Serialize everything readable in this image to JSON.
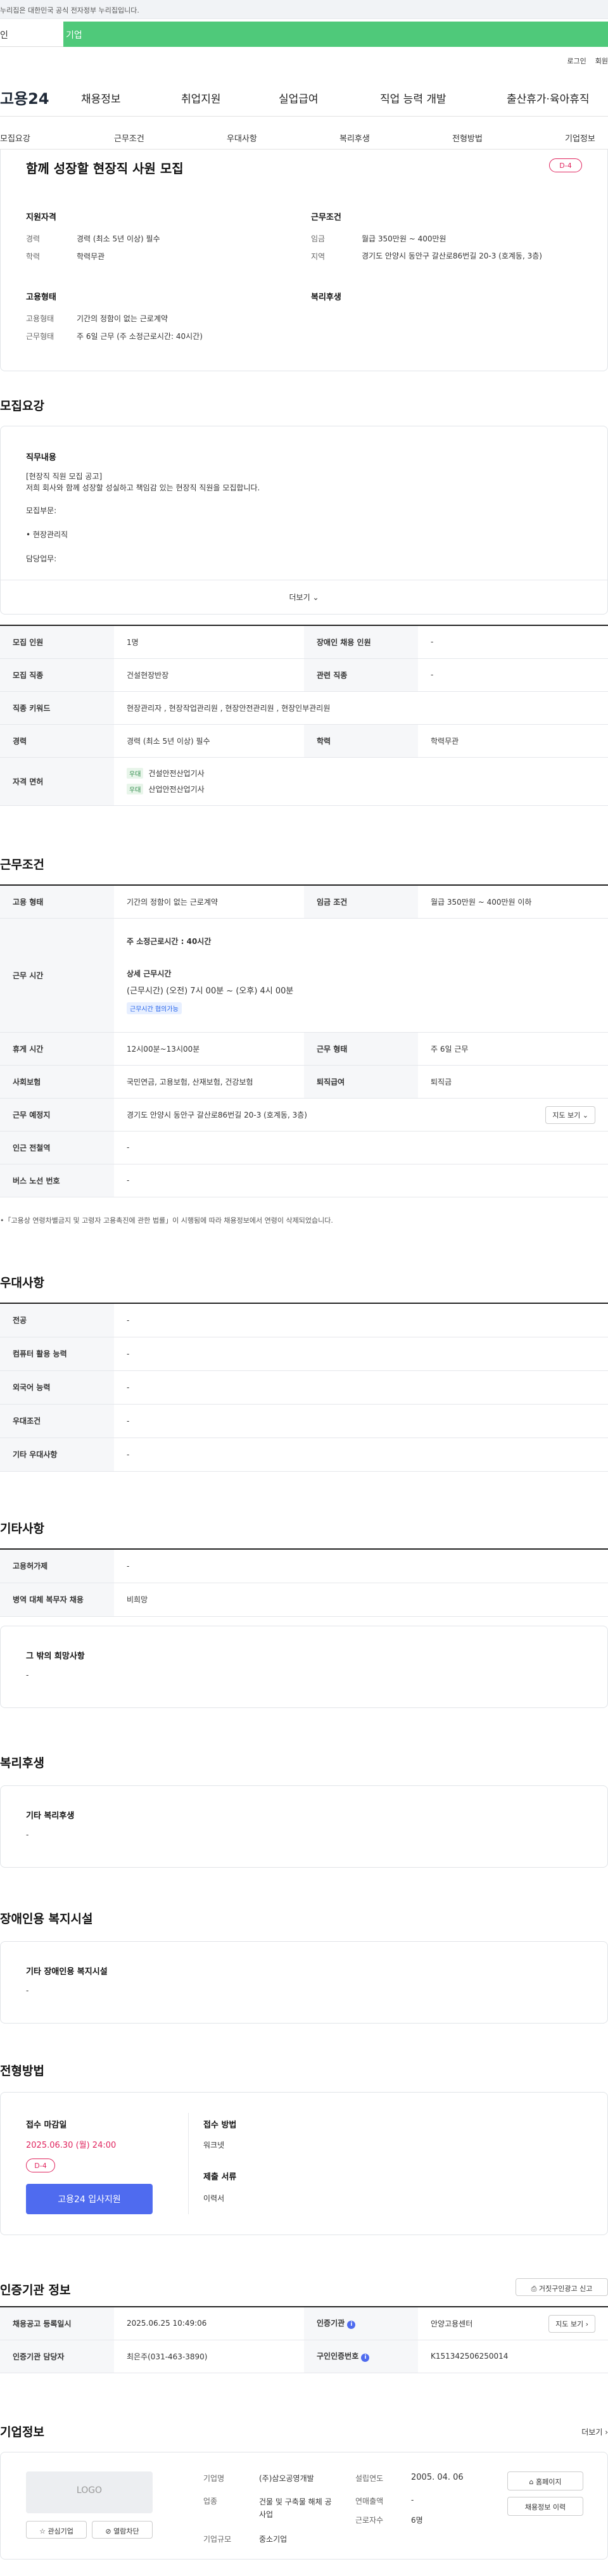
{
  "gov_banner": "누리집은 대한민국 공식 전자정부 누리집입니다.",
  "user_tabs": {
    "person": "인",
    "company": "기업"
  },
  "top_links": {
    "login": "로그인",
    "join": "회원"
  },
  "gnb": {
    "logo": "고용24",
    "menu": [
      "채용정보",
      "취업지원",
      "실업급여",
      "직업 능력 개발",
      "출산휴가·육아휴직"
    ]
  },
  "subnav": [
    "모집요강",
    "근무조건",
    "우대사항",
    "복리후생",
    "전형방법",
    "기업정보"
  ],
  "summary": {
    "title": "함께 성장할 현장직 사원 모집",
    "dday": "D-4",
    "qual_h": "지원자격",
    "exp_l": "경력",
    "exp_v": "경력 (최소 5년 이상) 필수",
    "edu_l": "학력",
    "edu_v": "학력무관",
    "cond_h": "근무조건",
    "wage_l": "임금",
    "wage_v": "월급 350만원 ~ 400만원",
    "loc_l": "지역",
    "loc_v": "경기도 안양시 동안구 갈산로86번길 20-3 (호계동, 3층)",
    "emp_h": "고용형태",
    "type_l": "고용형태",
    "type_v": "기간의 정함이 없는 근로계약",
    "work_l": "근무형태",
    "work_v": "주 6일 근무 (주 소정근로시간: 40시간)",
    "welfare_h": "복리후생"
  },
  "recruit": {
    "title": "모집요강",
    "duty_h": "직무내용",
    "duty_lines": [
      "[현장직 직원 모집 공고]",
      "저희 회사와 함께 성장할 성실하고 책임감 있는 현장직 직원을 모집합니다.",
      "모집부문:",
      "• 현장관리직",
      "담당업무:"
    ],
    "more": "더보기",
    "rows": {
      "r1": {
        "k1": "모집 인원",
        "v1": "1명",
        "k2": "장애인 채용 인원",
        "v2": "-"
      },
      "r2": {
        "k1": "모집 직종",
        "v1": "건설현장반장",
        "k2": "관련 직종",
        "v2": "-"
      },
      "r3": {
        "k1": "직종 키워드",
        "v1": "현장관리자 , 현장작업관리원 , 현장안전관리원 , 현장인부관리원"
      },
      "r4": {
        "k1": "경력",
        "v1": "경력 (최소 5년 이상) 필수",
        "k2": "학력",
        "v2": "학력무관"
      },
      "r5": {
        "k1": "자격 면허",
        "tag": "우대",
        "lic1": "건설안전산업기사",
        "lic2": "산업안전산업기사"
      }
    }
  },
  "conditions": {
    "title": "근무조건",
    "emp_k": "고용 형태",
    "emp_v": "기간의 정함이 없는 근로계약",
    "wage_k": "임금 조건",
    "wage_v": "월급 350만원 ~ 400만원 이하",
    "hours_k": "근무 시간",
    "hours_main": "주 소정근로시간 : 40시간",
    "hours_detail_h": "상세 근무시간",
    "hours_detail": "(근무시간) (오전) 7시 00분 ~ (오후) 4시 00분",
    "hours_tag": "근무시간 협의가능",
    "rest_k": "휴게 시간",
    "rest_v": "12시00분~13시00분",
    "form_k": "근무 형태",
    "form_v": "주 6일 근무",
    "ins_k": "사회보험",
    "ins_v": "국민연금, 고용보험, 산재보험, 건강보험",
    "sev_k": "퇴직급여",
    "sev_v": "퇴직금",
    "place_k": "근무 예정지",
    "place_v": "경기도 안양시 동안구 갈산로86번길 20-3 (호계동, 3층)",
    "map_btn": "지도 보기",
    "subway_k": "인근 전철역",
    "subway_v": "-",
    "bus_k": "버스 노선 번호",
    "bus_v": "-",
    "note": "•「고용상 연령차별금지 및 고령자 고용촉진에 관한 법률」이 시행됨에 따라 채용정보에서 연령이 삭제되었습니다."
  },
  "pref": {
    "title": "우대사항",
    "rows": [
      [
        "전공",
        "-"
      ],
      [
        "컴퓨터 활용 능력",
        "-"
      ],
      [
        "외국어 능력",
        "-"
      ],
      [
        "우대조건",
        "-"
      ],
      [
        "기타 우대사항",
        "-"
      ]
    ]
  },
  "etc": {
    "title": "기타사항",
    "rows": [
      [
        "고용허가제",
        "-"
      ],
      [
        "병역 대체 복무자 채용",
        "비희망"
      ]
    ],
    "wish_h": "그 밖의 희망사항",
    "wish_v": "-"
  },
  "welfare": {
    "title": "복리후생",
    "h": "기타 복리후생",
    "v": "-"
  },
  "disabled": {
    "title": "장애인용 복지시설",
    "h": "기타 장애인용 복지시설",
    "v": "-"
  },
  "process": {
    "title": "전형방법",
    "deadline_h": "접수 마감일",
    "deadline": "2025.06.30 (월) 24:00",
    "dday": "D-4",
    "apply": "고용24 입사지원",
    "method_h": "접수 방법",
    "method_v": "워크넷",
    "docs_h": "제출 서류",
    "docs_v": "이력서"
  },
  "cert": {
    "title": "인증기관 정보",
    "report": "거짓구인광고 신고",
    "reg_k": "채용공고 등록일시",
    "reg_v": "2025.06.25 10:49:06",
    "org_k": "인증기관",
    "org_v": "안양고용센터",
    "map_btn": "지도 보기",
    "mgr_k": "인증기관 담당자",
    "mgr_v": "최은주(031-463-3890)",
    "no_k": "구인인증번호",
    "no_v": "K151342506250014"
  },
  "company": {
    "title": "기업정보",
    "more": "더보기",
    "logo": "LOGO",
    "fav": "관심기업",
    "block": "열람차단",
    "name_k": "기업명",
    "name_v": "(주)삼오공영개발",
    "ind_k": "업종",
    "ind_v": "건물 및 구축물 해체 공사업",
    "scale_k": "기업규모",
    "scale_v": "중소기업",
    "est_k": "설립연도",
    "est_v": "2005. 04. 06",
    "sales_k": "연매출액",
    "sales_v": "-",
    "emp_k": "근로자수",
    "emp_v": "6명",
    "home_btn": "홈페이지",
    "jobs_btn": "채용정보 이력"
  },
  "colors": {
    "accent": "#4fc97a",
    "primary": "#4f6bef",
    "dday": "#e0245e"
  }
}
